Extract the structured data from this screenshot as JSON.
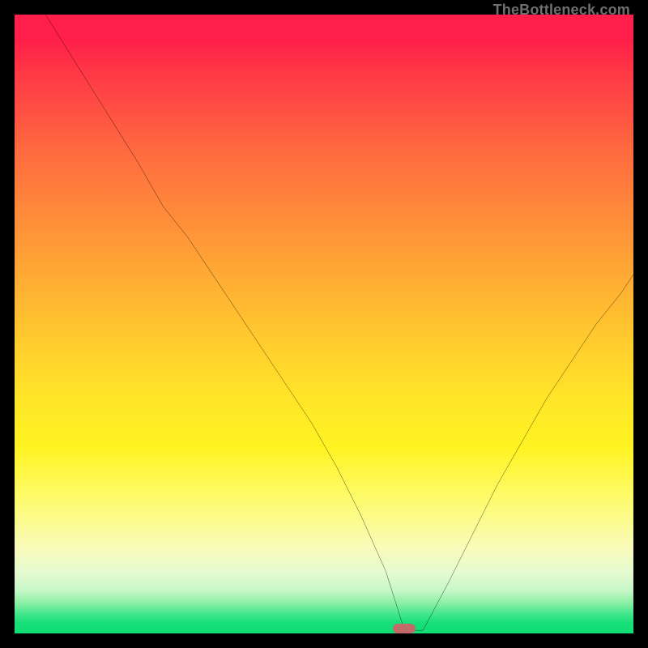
{
  "watermark": "TheBottleneck.com",
  "marker": {
    "x_pct": 63,
    "y_pct": 99.2,
    "color": "#c06a6a"
  },
  "chart_data": {
    "type": "line",
    "title": "",
    "xlabel": "",
    "ylabel": "",
    "xlim": [
      0,
      100
    ],
    "ylim": [
      0,
      100
    ],
    "grid": false,
    "legend": false,
    "background": "gradient-rainbow-vertical",
    "series": [
      {
        "name": "bottleneck-curve",
        "color": "#000000",
        "x": [
          5,
          10,
          15,
          20,
          24,
          28,
          32,
          36,
          40,
          44,
          48,
          52,
          56,
          60,
          63,
          66,
          70,
          74,
          78,
          82,
          86,
          90,
          94,
          98,
          100
        ],
        "values": [
          100,
          92,
          84,
          76,
          69,
          64,
          58,
          52,
          46,
          40,
          34,
          27,
          19,
          10,
          0.5,
          0.5,
          8,
          16,
          24,
          31,
          38,
          44,
          50,
          55,
          58
        ]
      }
    ],
    "annotations": [
      {
        "type": "marker",
        "shape": "pill",
        "x": 63,
        "y": 0.5,
        "color": "#c06a6a"
      }
    ]
  }
}
